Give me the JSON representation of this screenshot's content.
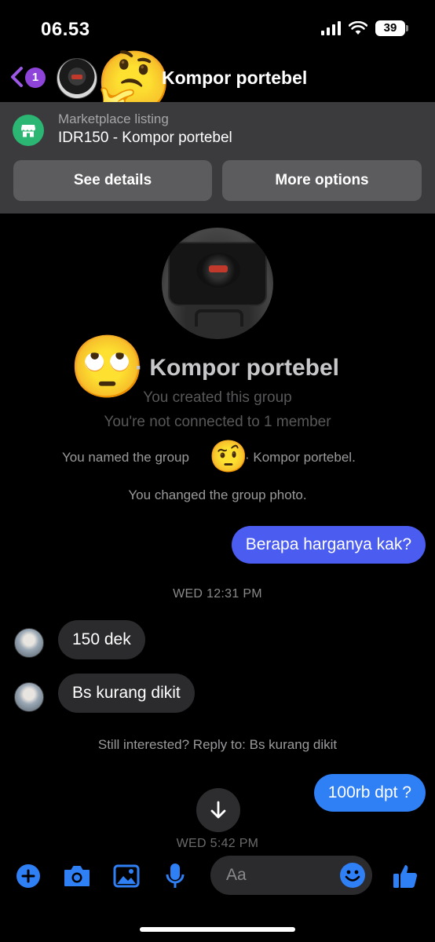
{
  "status_bar": {
    "time": "06.53",
    "battery": "39"
  },
  "header": {
    "back_badge": "1",
    "title": "Kompor portebel",
    "emoji": "🤔"
  },
  "marketplace": {
    "label": "Marketplace listing",
    "title": "IDR150 - Kompor portebel",
    "see_details_label": "See details",
    "more_options_label": "More options"
  },
  "group": {
    "emoji": "🙄",
    "name": "· Kompor portebel",
    "created": "You created this group",
    "members": "You're not connected to 1 member",
    "named_prefix": "You named the group",
    "named_emoji": "🤨",
    "named_suffix": "· Kompor portebel.",
    "photo_changed": "You changed the group photo."
  },
  "messages": {
    "out_1": "Berapa harganya kak?",
    "timestamp_1": "WED 12:31 PM",
    "in_1": "150 dek",
    "in_2": "Bs kurang dikit",
    "still_interested": "Still interested? Reply to: Bs kurang dikit",
    "out_2": "100rb dpt ?",
    "timestamp_2": "WED 5:42 PM"
  },
  "composer": {
    "placeholder": "Aa"
  },
  "colors": {
    "accent": "#4b5cf0",
    "icon_blue": "#2f7ff5",
    "marketplace_green": "#2bb673",
    "badge_purple": "#8e44d9"
  },
  "icons": [
    "back-arrow-icon",
    "wifi-icon",
    "signal-icon",
    "battery-icon",
    "marketplace-icon",
    "arrow-down-icon",
    "plus-icon",
    "camera-icon",
    "gallery-icon",
    "microphone-icon",
    "emoji-icon",
    "like-icon"
  ]
}
